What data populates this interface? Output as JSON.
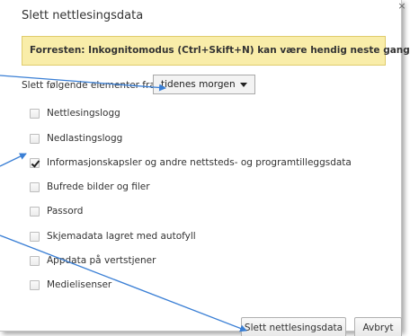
{
  "dialog": {
    "title": "Slett nettlesingsdata",
    "close_glyph": "×"
  },
  "infobar": {
    "text": "Forresten: Inkognitomodus (Ctrl+Skift+N) kan være hendig neste gang."
  },
  "time_range": {
    "label": "Slett følgende elementer fra:",
    "selected": "tidenes morgen"
  },
  "options": [
    {
      "label": "Nettlesingslogg",
      "checked": false
    },
    {
      "label": "Nedlastingslogg",
      "checked": false
    },
    {
      "label": "Informasjonskapsler og andre nettsteds- og programtilleggsdata",
      "checked": true
    },
    {
      "label": "Bufrede bilder og filer",
      "checked": false
    },
    {
      "label": "Passord",
      "checked": false
    },
    {
      "label": "Skjemadata lagret med autofyll",
      "checked": false
    },
    {
      "label": "Appdata på vertstjener",
      "checked": false
    },
    {
      "label": "Medielisenser",
      "checked": false
    }
  ],
  "buttons": {
    "clear": "Slett nettlesingsdata",
    "cancel": "Avbryt"
  },
  "colors": {
    "infobar_bg": "#f9eda9",
    "arrow": "#3a7fd5"
  }
}
